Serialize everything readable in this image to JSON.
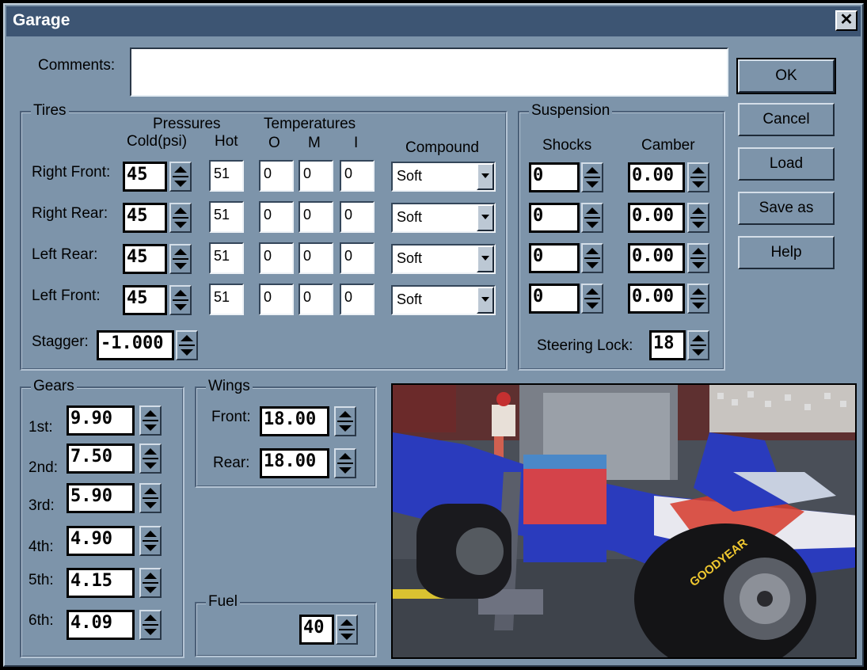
{
  "window": {
    "title": "Garage",
    "close": "✕"
  },
  "comments": {
    "label": "Comments:",
    "value": ""
  },
  "buttons": {
    "ok": "OK",
    "cancel": "Cancel",
    "load": "Load",
    "save_as": "Save as",
    "help": "Help"
  },
  "tires": {
    "legend": "Tires",
    "headers": {
      "pressures": "Pressures",
      "cold": "Cold(psi)",
      "hot": "Hot",
      "temperatures": "Temperatures",
      "o": "O",
      "m": "M",
      "i": "I",
      "compound": "Compound"
    },
    "rows": [
      {
        "label": "Right Front:",
        "cold": "45",
        "hot": "51",
        "o": "0",
        "m": "0",
        "i": "0",
        "compound": "Soft"
      },
      {
        "label": "Right Rear:",
        "cold": "45",
        "hot": "51",
        "o": "0",
        "m": "0",
        "i": "0",
        "compound": "Soft"
      },
      {
        "label": "Left Rear:",
        "cold": "45",
        "hot": "51",
        "o": "0",
        "m": "0",
        "i": "0",
        "compound": "Soft"
      },
      {
        "label": "Left Front:",
        "cold": "45",
        "hot": "51",
        "o": "0",
        "m": "0",
        "i": "0",
        "compound": "Soft"
      }
    ],
    "stagger_label": "Stagger:",
    "stagger_value": "-1.000"
  },
  "suspension": {
    "legend": "Suspension",
    "shocks_header": "Shocks",
    "camber_header": "Camber",
    "rows": [
      {
        "shock": "0",
        "camber": "0.00"
      },
      {
        "shock": "0",
        "camber": "0.00"
      },
      {
        "shock": "0",
        "camber": "0.00"
      },
      {
        "shock": "0",
        "camber": "0.00"
      }
    ],
    "steering_lock_label": "Steering Lock:",
    "steering_lock_value": "18"
  },
  "gears": {
    "legend": "Gears",
    "items": [
      {
        "label": "1st:",
        "value": "9.90"
      },
      {
        "label": "2nd:",
        "value": "7.50"
      },
      {
        "label": "3rd:",
        "value": "5.90"
      },
      {
        "label": "4th:",
        "value": "4.90"
      },
      {
        "label": "5th:",
        "value": "4.15"
      },
      {
        "label": "6th:",
        "value": "4.09"
      }
    ]
  },
  "wings": {
    "legend": "Wings",
    "front_label": "Front:",
    "front_value": "18.00",
    "rear_label": "Rear:",
    "rear_value": "18.00"
  },
  "fuel": {
    "legend": "Fuel",
    "value": "40"
  },
  "car_image": {
    "tire_brand": "GOODYEAR"
  }
}
